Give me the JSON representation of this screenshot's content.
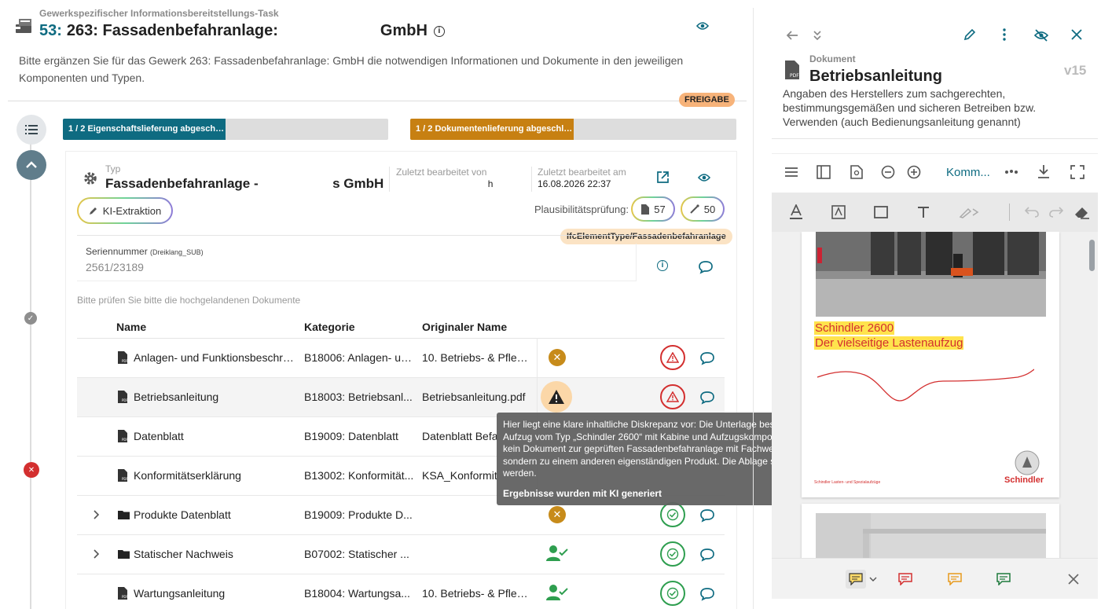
{
  "header": {
    "pretitle": "Gewerkspezifischer Informationsbereitstellungs-Task",
    "title_num": "53:",
    "title_main": "263: Fassadenbefahranlage:",
    "title_suffix": "GmbH",
    "description": "Bitte ergänzen Sie für das Gewerk 263: Fassadenbefahranlage:                                    GmbH die notwendigen Informationen und Dokumente in den jeweiligen Komponenten und Typen.",
    "badge": "FREIGABE"
  },
  "progress": {
    "properties": {
      "label": "1 / 2 Eigenschaftslieferung abgeschlos...",
      "fraction": 0.5,
      "color": "#0e6b81"
    },
    "documents": {
      "label": "1 / 2 Dokumentenlieferung abgeschloss...",
      "fraction": 0.5,
      "color": "#c78012"
    }
  },
  "type_card": {
    "type_label": "Typ",
    "type_name": "Fassadenbefahranlage -                    s GmbH",
    "last_edited_by_label": "Zuletzt bearbeitet von",
    "last_edited_by_value": "                                   h",
    "last_edited_at_label": "Zuletzt bearbeitet am",
    "last_edited_at_value": "16.08.2026 22:37",
    "ki_button": "KI-Extraktion",
    "plausibility_label": "Plausibilitätsprüfung:",
    "plausibility_docs": "57",
    "plausibility_props": "50",
    "ifc_tag": "IfcElementType/Fassadenbefahranlage",
    "serial_label": "Seriennummer",
    "serial_sub": "(Dreiklang_SUB)",
    "serial_value": "2561/23189",
    "hint": "Bitte prüfen Sie bitte die hochgelandenen Dokumente"
  },
  "table": {
    "headers": {
      "name": "Name",
      "category": "Kategorie",
      "original": "Originaler Name"
    },
    "rows": [
      {
        "name": "Anlagen- und Funktionsbeschreib",
        "category": "B18006: Anlagen- un...",
        "original": "10. Betriebs- & Pfleg..."
      },
      {
        "name": "Betriebsanleitung",
        "category": "B18003: Betriebsanl...",
        "original": "Betriebsanleitung.pdf"
      },
      {
        "name": "Datenblatt",
        "category": "B19009: Datenblatt",
        "original": "Datenblatt Befa"
      },
      {
        "name": "Konformitätserklärung",
        "category": "B13002: Konformität...",
        "original": "KSA_Konformit"
      },
      {
        "name": "Produkte Datenblatt",
        "category": "B19009: Produkte D...",
        "original": ""
      },
      {
        "name": "Statischer Nachweis",
        "category": "B07002: Statischer ...",
        "original": ""
      },
      {
        "name": "Wartungsanleitung",
        "category": "B18004: Wartungsa...",
        "original": "10. Betriebs- & Pfleg..."
      }
    ]
  },
  "tooltip": {
    "text": "Hier liegt eine klare inhaltliche Diskrepanz vor: Die Unterlage beschreibt einen Aufzug vom Typ „Schindler 2600“ mit Kabine und Aufzugskomponenten,. Das ist kein Dokument zur geprüften Fassadenbefahranlage mit Fachwerkausleger, sondern zu einem anderen eigenständigen Produkt. Die Ablage sollte korrigiert werden.",
    "footer": "Ergebnisse wurden mit KI generiert"
  },
  "document_panel": {
    "label": "Dokument",
    "title": "Betriebsanleitung",
    "version": "v15",
    "description": "Angaben des Herstellers zum sachgerechten, bestimmungsgemäßen und sicheren Betreiben bzw. Verwenden (auch Bedienungsanleitung genannt)",
    "toolbar_dropdown": "Komm...",
    "pdf_heading1": "Schindler 2600",
    "pdf_heading2": "Der vielseitige Lastenaufzug",
    "pdf_brand": "Schindler",
    "pdf_footer_small": "Schindler Lasten- und Spezialaufzüge"
  },
  "colors": {
    "teal": "#0e6b81",
    "orange": "#c78012",
    "red": "#d32f2f",
    "green": "#2e9e4f"
  }
}
